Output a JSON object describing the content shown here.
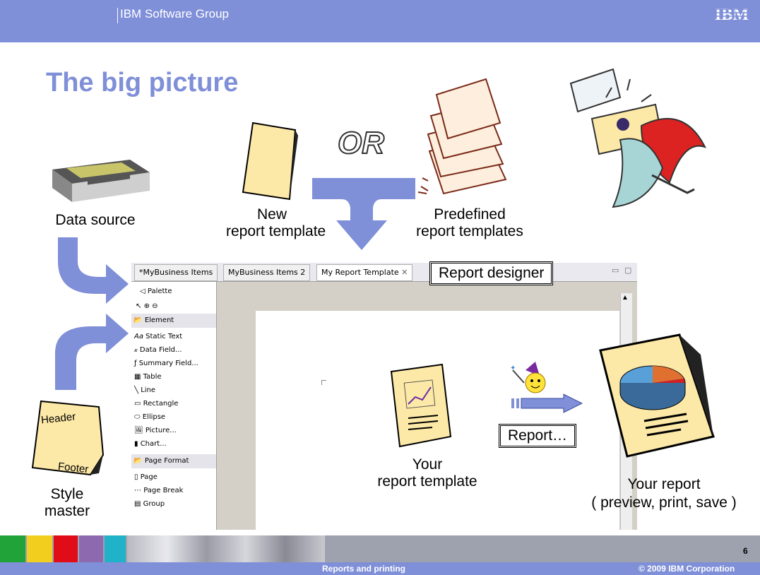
{
  "header": {
    "group": "IBM Software Group",
    "logo_text": "IBM",
    "color": "#7f8fd8"
  },
  "title": "The big picture",
  "labels": {
    "data_source": "Data source",
    "new_template": [
      "New",
      "report template"
    ],
    "or": "OR",
    "predefined": [
      "Predefined",
      "report templates"
    ],
    "style_master": [
      "Style",
      "master"
    ],
    "header_word": "Header",
    "footer_word": "Footer",
    "report_designer": "Report designer",
    "your_template": [
      "Your",
      "report template"
    ],
    "report_button": "Report…",
    "your_report": [
      "Your report",
      "( preview, print, save )"
    ]
  },
  "editor": {
    "tabs": [
      "*MyBusiness Items",
      "MyBusiness Items 2",
      "My Report Template"
    ],
    "palette_title": "Palette",
    "element_category": "Element",
    "element_items": [
      "Static Text",
      "Data Field...",
      "Summary Field...",
      "Table",
      "Line",
      "Rectangle",
      "Ellipse",
      "Picture...",
      "Chart..."
    ],
    "page_format_category": "Page Format",
    "page_format_items": [
      "Page",
      "Page Break",
      "Group"
    ]
  },
  "footer": {
    "center": "Reports and printing",
    "right": "© 2009 IBM Corporation",
    "page": "6"
  },
  "colors": {
    "accent": "#7f8fd8",
    "arrow": "#7f8fd8",
    "paper": "#fde9a7"
  }
}
